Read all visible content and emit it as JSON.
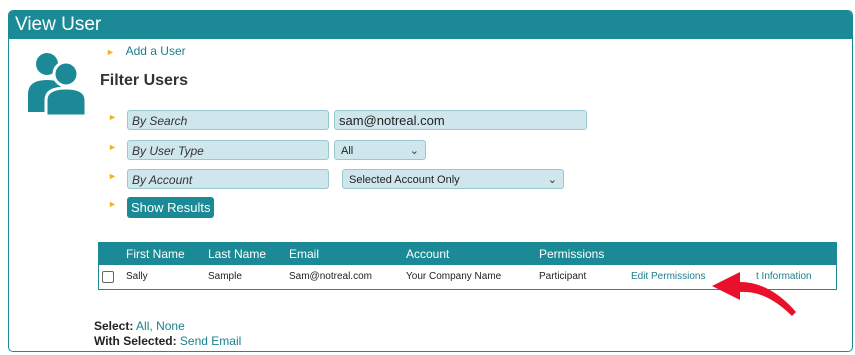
{
  "window": {
    "title": "View User"
  },
  "actions": {
    "add_user": "Add a User"
  },
  "filter": {
    "title": "Filter Users",
    "search": {
      "label": "By Search",
      "value": "sam@notreal.com"
    },
    "user_type": {
      "label": "By User Type",
      "selected": "All"
    },
    "account": {
      "label": "By Account",
      "selected": "Selected Account Only"
    },
    "show_button": "Show Results"
  },
  "table": {
    "columns": [
      "First Name",
      "Last Name",
      "Email",
      "Account",
      "Permissions"
    ],
    "rows": [
      {
        "first_name": "Sally",
        "last_name": "Sample",
        "email": "Sam@notreal.com",
        "account": "Your Company Name",
        "permissions": "Participant",
        "edit_permissions": "Edit Permissions",
        "edit_information": "t Information"
      }
    ]
  },
  "footer": {
    "select_label": "Select:",
    "select_all": "All",
    "select_sep": ",",
    "select_none": "None",
    "with_selected_label": "With Selected:",
    "send_email": "Send Email"
  },
  "colors": {
    "accent": "#1b8a96",
    "bullet": "#f2b31a",
    "arrow": "#e8102a",
    "field_bg": "#cfe6ec"
  },
  "icons": {
    "user_group": "users-icon",
    "bullet": "triangle-bullet-icon",
    "dropdown": "chevron-down-icon",
    "annotation": "red-arrow-icon"
  }
}
